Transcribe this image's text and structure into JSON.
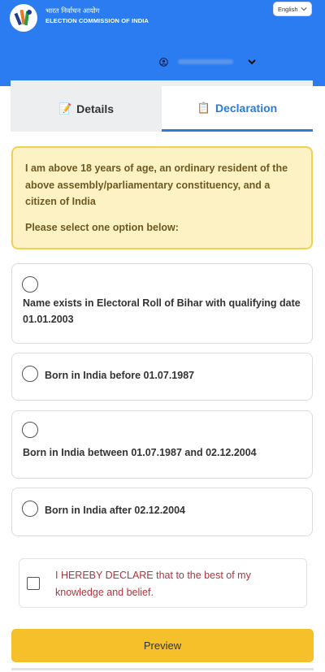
{
  "header": {
    "org_hindi": "भारत निर्वाचन आयोग",
    "org_english": "ELECTION COMMISSION OF INDIA",
    "language": "English",
    "brand_color": "#2b7bf1"
  },
  "tabs": [
    {
      "label": "Details",
      "icon": "memo-icon"
    },
    {
      "label": "Declaration",
      "icon": "clipboard-icon",
      "active": true
    }
  ],
  "notice": {
    "text": "I am above 18 years of age, an ordinary resident of the above assembly/parliamentary constituency, and a citizen of India",
    "prompt": "Please select one option below:"
  },
  "options": [
    {
      "label": "Name exists in Electoral Roll of Bihar with qualifying date 01.01.2003"
    },
    {
      "label": "Born in India before 01.07.1987"
    },
    {
      "label": "Born in India between 01.07.1987 and 02.12.2004"
    },
    {
      "label": "Born in India after 02.12.2004"
    }
  ],
  "declaration": {
    "text": "I HEREBY DECLARE that to the best of my knowledge and belief."
  },
  "preview_button": "Preview",
  "colors": {
    "accent": "#2b7bd8",
    "notice_bg": "#fdf2c4",
    "notice_border": "#f3cf55",
    "declare_text": "#b0353d",
    "button": "#f6c02b"
  }
}
